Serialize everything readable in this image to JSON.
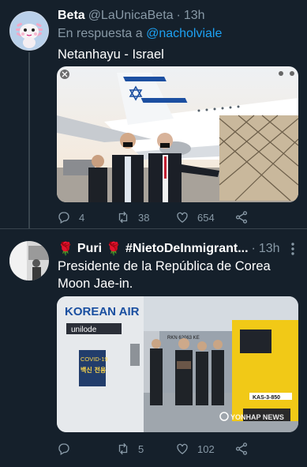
{
  "tweets": [
    {
      "name": "Beta",
      "handle": "@LaUnicaBeta",
      "separator": "·",
      "time": "13h",
      "reply_prefix": "En respuesta a",
      "reply_mention": "@nacholviale",
      "text": "Netanhayu - Israel",
      "media_icon": "photo-netanyahu-cargo-plane",
      "reply_count": "4",
      "retweet_count": "38",
      "like_count": "654"
    },
    {
      "name_emoji_left": "🌹",
      "name": "Puri",
      "name_emoji_right": "🌹",
      "name_hashtag": "#NietoDeInmigrant...",
      "separator": "·",
      "time": "13h",
      "text_line1": "Presidente de la República de Corea",
      "text_line2": "Moon Jae-in.",
      "media_icon": "photo-moon-jae-in-korean-air-cargo",
      "media_texts": {
        "airline": "KOREAN AIR",
        "unilode": "unilode",
        "covid1": "COVID-19",
        "covid2": "백신 전용",
        "truck_plate": "KAS-3-850",
        "ramp_label": "RKN 62063 KE",
        "watermark": "YONHAP NEWS"
      },
      "reply_count": "",
      "retweet_count": "5",
      "like_count": "102"
    }
  ],
  "colors": {
    "background": "#15202b",
    "divider": "#38444d",
    "secondary_text": "#8899a6",
    "link": "#1da1f2"
  }
}
